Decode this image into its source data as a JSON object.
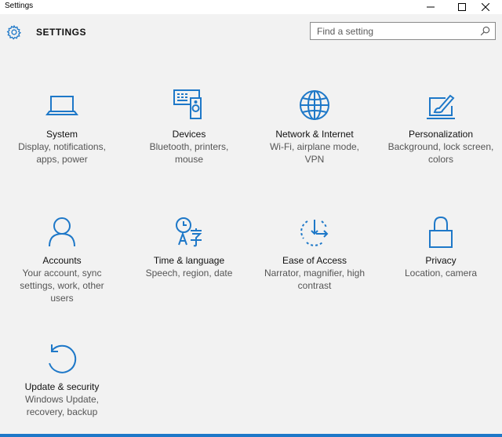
{
  "window": {
    "title": "Settings"
  },
  "header": {
    "title": "SETTINGS",
    "search_placeholder": "Find a setting"
  },
  "colors": {
    "accent": "#1e78c8",
    "background": "#f2f2f2"
  },
  "tiles": [
    {
      "icon": "laptop-icon",
      "label": "System",
      "desc": "Display, notifications, apps, power"
    },
    {
      "icon": "devices-icon",
      "label": "Devices",
      "desc": "Bluetooth, printers, mouse"
    },
    {
      "icon": "globe-icon",
      "label": "Network & Internet",
      "desc": "Wi-Fi, airplane mode, VPN"
    },
    {
      "icon": "personalization-icon",
      "label": "Personalization",
      "desc": "Background, lock screen, colors"
    },
    {
      "icon": "person-icon",
      "label": "Accounts",
      "desc": "Your account, sync settings, work, other users"
    },
    {
      "icon": "time-language-icon",
      "label": "Time & language",
      "desc": "Speech, region, date"
    },
    {
      "icon": "ease-of-access-icon",
      "label": "Ease of Access",
      "desc": "Narrator, magnifier, high contrast"
    },
    {
      "icon": "lock-icon",
      "label": "Privacy",
      "desc": "Location, camera"
    },
    {
      "icon": "update-icon",
      "label": "Update & security",
      "desc": "Windows Update, recovery, backup"
    }
  ]
}
